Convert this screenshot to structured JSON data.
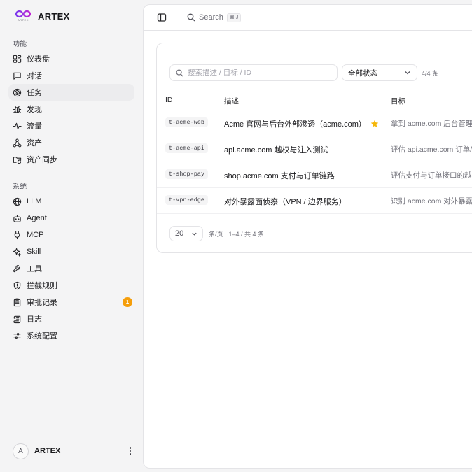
{
  "brand": {
    "name": "ARTEX",
    "logo_text": "ARTEX"
  },
  "sections": {
    "features": "功能",
    "system": "系统"
  },
  "nav_features": [
    {
      "label": "仪表盘",
      "icon": "dashboard-icon"
    },
    {
      "label": "对话",
      "icon": "chat-icon"
    },
    {
      "label": "任务",
      "icon": "target-icon",
      "active": true
    },
    {
      "label": "发现",
      "icon": "bug-icon"
    },
    {
      "label": "流量",
      "icon": "activity-icon"
    },
    {
      "label": "资产",
      "icon": "network-icon"
    },
    {
      "label": "资产同步",
      "icon": "folder-sync-icon"
    }
  ],
  "nav_system": [
    {
      "label": "LLM",
      "icon": "globe-icon"
    },
    {
      "label": "Agent",
      "icon": "bot-icon"
    },
    {
      "label": "MCP",
      "icon": "plug-icon"
    },
    {
      "label": "Skill",
      "icon": "sparkles-icon"
    },
    {
      "label": "工具",
      "icon": "wrench-icon"
    },
    {
      "label": "拦截规则",
      "icon": "shield-icon"
    },
    {
      "label": "审批记录",
      "icon": "clipboard-icon",
      "badge": "1"
    },
    {
      "label": "日志",
      "icon": "scroll-icon"
    },
    {
      "label": "系统配置",
      "icon": "settings-sliders-icon"
    }
  ],
  "user": {
    "avatar": "A",
    "name": "ARTEX"
  },
  "topbar": {
    "search_label": "Search",
    "search_shortcut": "⌘ J"
  },
  "filters": {
    "search_placeholder": "搜索描述 / 目标 / ID",
    "status_value": "全部状态",
    "count": "4/4 条"
  },
  "table": {
    "headers": {
      "id": "ID",
      "desc": "描述",
      "target": "目标"
    },
    "rows": [
      {
        "id": "t-acme-web",
        "desc": "Acme 官网与后台外部渗透（acme.com）",
        "starred": true,
        "target": "拿到 acme.com 后台管理"
      },
      {
        "id": "t-acme-api",
        "desc": "api.acme.com 越权与注入测试",
        "starred": false,
        "target": "评估 api.acme.com 订单/"
      },
      {
        "id": "t-shop-pay",
        "desc": "shop.acme.com 支付与订单链路",
        "starred": false,
        "target": "评估支付与订单接口的越"
      },
      {
        "id": "t-vpn-edge",
        "desc": "对外暴露面侦察（VPN / 边界服务）",
        "starred": false,
        "target": "识别 acme.com 对外暴露"
      }
    ]
  },
  "pager": {
    "page_size": "20",
    "per_page": "条/页",
    "range": "1–4 / 共 4 条"
  },
  "colors": {
    "accent_active_bg": "#ececee",
    "badge": "#f59e0b",
    "star": "#f5b70a",
    "logo_a": "#7c3aed",
    "logo_b": "#c026d3"
  }
}
